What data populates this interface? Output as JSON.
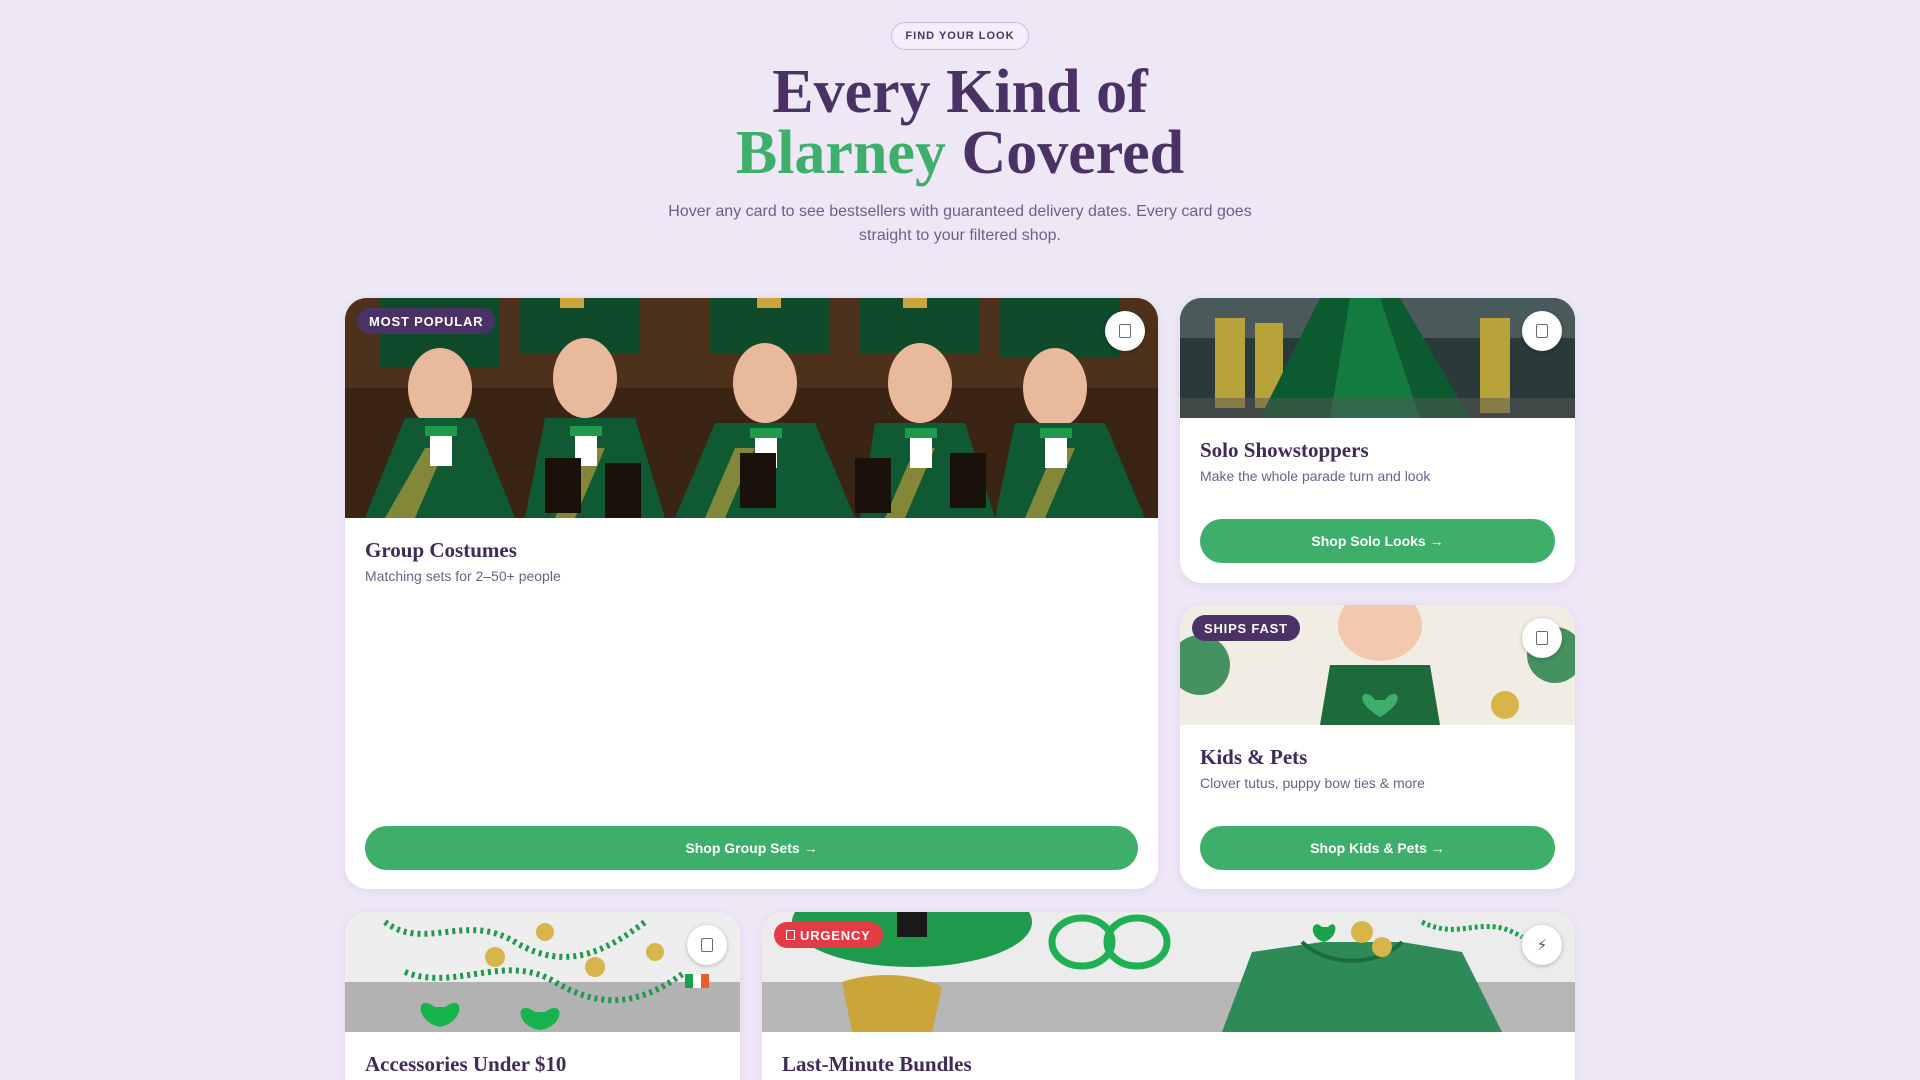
{
  "header": {
    "eyebrow": "FIND YOUR LOOK",
    "headline_line1": "Every Kind of",
    "headline_accent": "Blarney",
    "headline_rest": " Covered",
    "subcopy": "Hover any card to see bestsellers with guaranteed delivery dates. Every card goes straight to your filtered shop."
  },
  "cards": {
    "group": {
      "badge": "MOST POPULAR",
      "title": "Group Costumes",
      "desc": "Matching sets for 2–50+ people",
      "cta": "Shop Group Sets →",
      "fav_icon": "bookmark-icon"
    },
    "solo": {
      "title": "Solo Showstoppers",
      "desc": "Make the whole parade turn and look",
      "cta": "Shop Solo Looks →",
      "fav_icon": "bookmark-icon"
    },
    "kids": {
      "badge": "SHIPS FAST",
      "title": "Kids & Pets",
      "desc": "Clover tutus, puppy bow ties & more",
      "cta": "Shop Kids & Pets →",
      "fav_icon": "bookmark-icon"
    },
    "accessories": {
      "title": "Accessories Under $10",
      "fav_icon": "bookmark-icon"
    },
    "bundles": {
      "badge": "URGENCY",
      "title": "Last-Minute Bundles",
      "fav_icon": "lightning-icon",
      "fav_glyph": "⚡"
    }
  },
  "colors": {
    "background": "#ede7f6",
    "headline": "#4b3266",
    "accent_green": "#3daf6a",
    "badge_purple": "#4b3266",
    "badge_red": "#e53b46"
  }
}
